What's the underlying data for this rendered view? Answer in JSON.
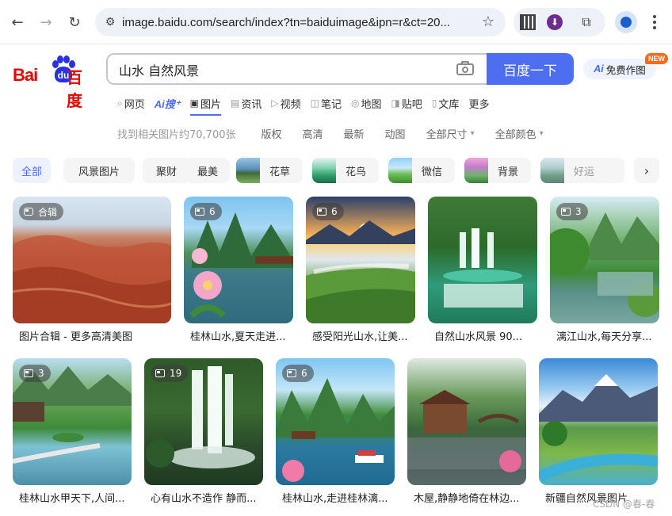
{
  "browser": {
    "url": "image.baidu.com/search/index?tn=baiduimage&ipn=r&ct=20...",
    "icons": [
      "back-icon",
      "forward-icon",
      "reload-icon",
      "tune-icon",
      "star-icon",
      "qr-code-icon",
      "download-icon",
      "extensions-icon",
      "profile-icon",
      "more-icon"
    ]
  },
  "header": {
    "logo_bai": "Bai",
    "logo_du": "du",
    "logo_hanzi": "百度",
    "query": "山水 自然风景",
    "search_button": "百度一下",
    "ai_draw_prefix": "Ai",
    "ai_draw": "免费作图",
    "new_badge": "NEW"
  },
  "tabs": [
    {
      "label": "网页",
      "icon": "search-icon"
    },
    {
      "label": "Ai搜⁺",
      "icon": ""
    },
    {
      "label": "图片",
      "icon": "image-icon"
    },
    {
      "label": "资讯",
      "icon": "news-icon"
    },
    {
      "label": "视频",
      "icon": "video-icon"
    },
    {
      "label": "笔记",
      "icon": "note-icon"
    },
    {
      "label": "地图",
      "icon": "map-icon"
    },
    {
      "label": "贴吧",
      "icon": "tieba-icon"
    },
    {
      "label": "文库",
      "icon": "doc-icon"
    },
    {
      "label": "更多",
      "icon": ""
    }
  ],
  "filters": {
    "count": "找到相关图片约70,700张",
    "items": [
      "版权",
      "高清",
      "最新",
      "动图"
    ],
    "size": "全部尺寸",
    "color": "全部颜色"
  },
  "chips": [
    "全部",
    "风景图片",
    "聚财",
    "最美",
    "花草",
    "花鸟",
    "微信",
    "背景",
    "好运"
  ],
  "results_row1": [
    {
      "badge": "合辑",
      "caption": "图片合辑 - 更多高清美图"
    },
    {
      "badge": "6",
      "caption": "桂林山水,夏天走进..."
    },
    {
      "badge": "6",
      "caption": "感受阳光山水,让美..."
    },
    {
      "badge": "",
      "caption": "自然山水风景 90..."
    },
    {
      "badge": "3",
      "caption": "漓江山水,每天分享..."
    }
  ],
  "results_row2": [
    {
      "badge": "3",
      "caption": "桂林山水甲天下,人间..."
    },
    {
      "badge": "19",
      "caption": "心有山水不造作 静而..."
    },
    {
      "badge": "6",
      "caption": "桂林山水,走进桂林漓..."
    },
    {
      "badge": "",
      "caption": "木屋,静静地倚在林边..."
    },
    {
      "badge": "",
      "caption": "新疆自然风景图片"
    }
  ],
  "watermark": "CSDN @春-春",
  "colors": {
    "accent": "#4e6ef2",
    "brand_red": "#e10602",
    "brand_blue": "#2932e1"
  }
}
